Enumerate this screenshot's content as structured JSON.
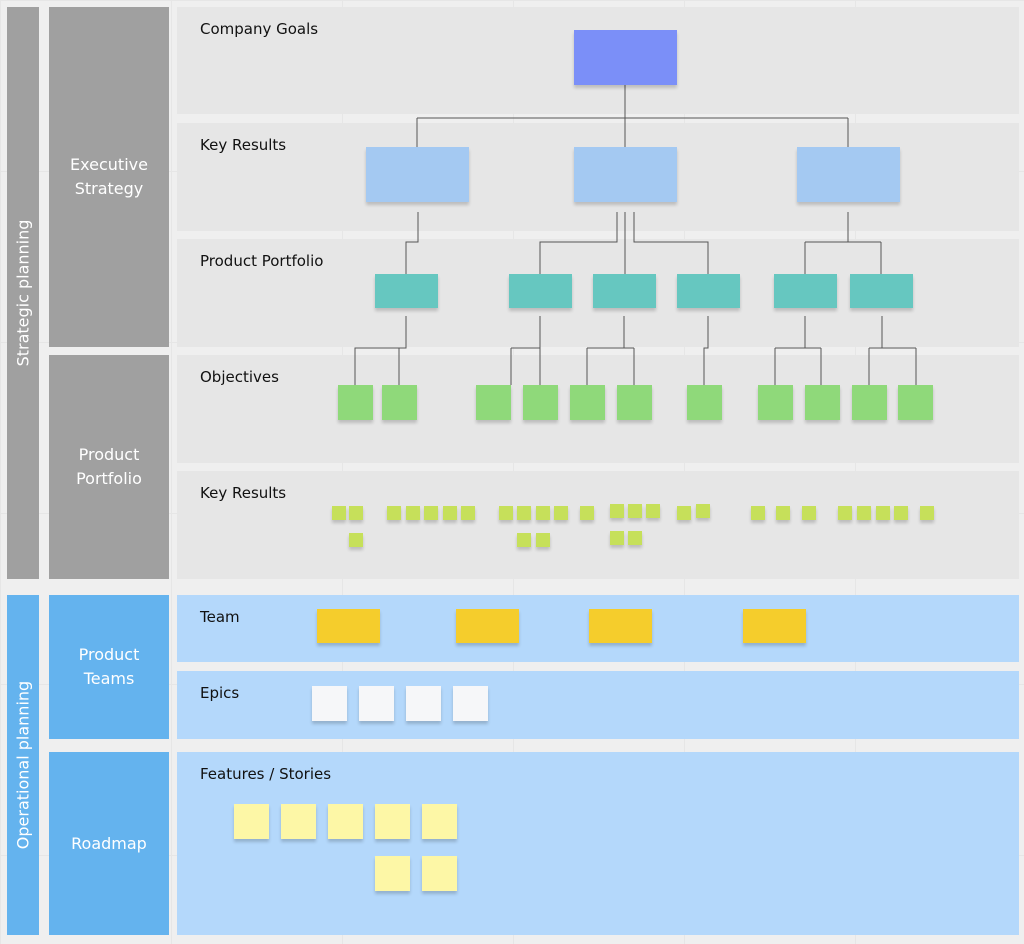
{
  "columns": {
    "strategic": "Strategic planning",
    "operational": "Operational planning",
    "executive_strategy": "Executive Strategy",
    "product_portfolio": "Product Portfolio",
    "product_teams": "Product Teams",
    "roadmap": "Roadmap"
  },
  "lanes": [
    {
      "label": "Company Goals"
    },
    {
      "label": "Key Results"
    },
    {
      "label": "Product Portfolio"
    },
    {
      "label": "Objectives"
    },
    {
      "label": "Key Results"
    },
    {
      "label": "Team"
    },
    {
      "label": "Epics"
    },
    {
      "label": "Features / Stories"
    }
  ],
  "colors": {
    "strategic_column": "#a0a0a0",
    "operational_column": "#64b3ee",
    "goal_note": "#7b8ff8",
    "key_result_note": "#a4c9f2",
    "portfolio_note": "#66c7c0",
    "objective_note": "#8fd97a",
    "small_key_result_note": "#c6e05a",
    "team_note": "#f5cd2c",
    "epic_note": "#f6f7f9",
    "story_note": "#fdf7a6",
    "connector": "#555555"
  }
}
